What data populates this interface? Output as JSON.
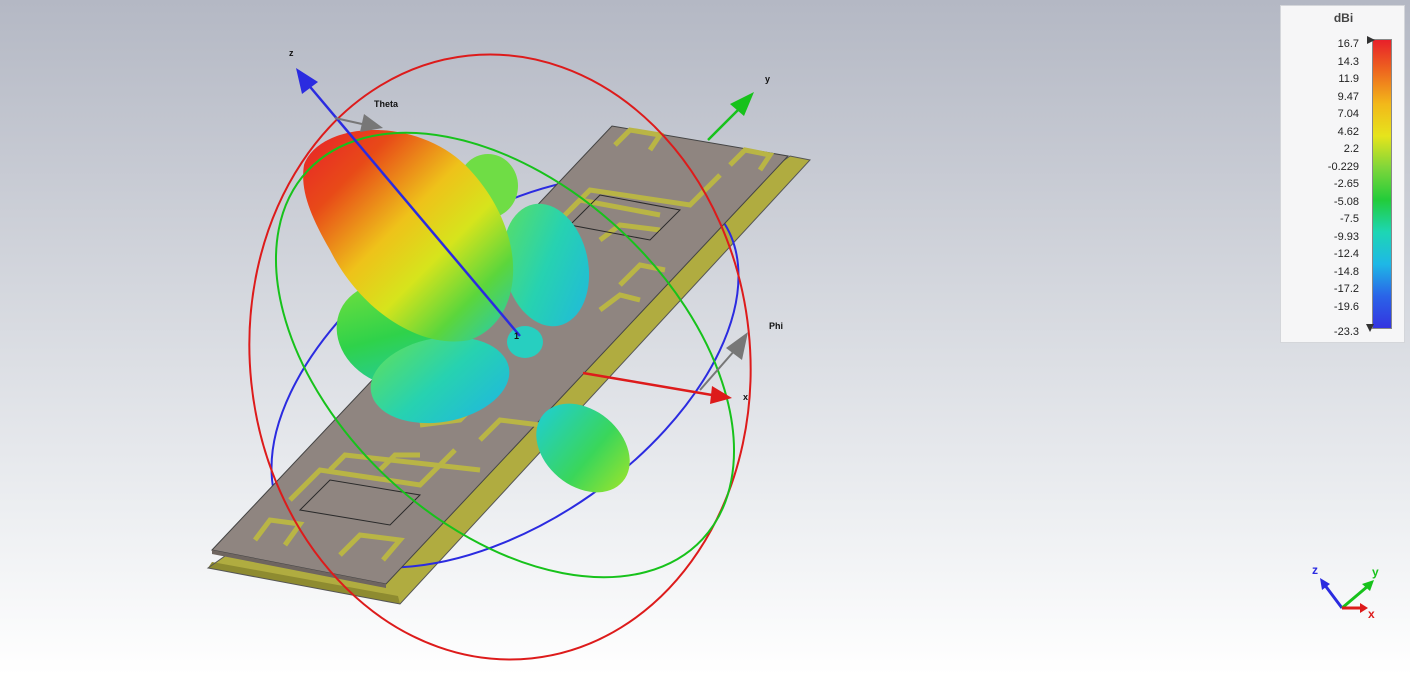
{
  "scene": {
    "axes": {
      "x": "x",
      "y": "y",
      "z": "z"
    },
    "angle_labels": {
      "theta": "Theta",
      "phi": "Phi"
    },
    "port_label": "1"
  },
  "legend": {
    "unit": "dBi",
    "ticks": [
      "16.7",
      "14.3",
      "11.9",
      "9.47",
      "7.04",
      "4.62",
      "2.2",
      "-0.229",
      "-2.65",
      "-5.08",
      "-7.5",
      "-9.93",
      "-12.4",
      "-14.8",
      "-17.2",
      "-19.6",
      "-23.3"
    ],
    "colors": [
      "#e8202a",
      "#ee6a1e",
      "#f2b81a",
      "#e6e41c",
      "#7ed63a",
      "#22cc3a",
      "#1dd6b4",
      "#1eb8e6",
      "#2a64e8",
      "#3434e0"
    ]
  },
  "triad": {
    "x": "x",
    "y": "y",
    "z": "z"
  }
}
